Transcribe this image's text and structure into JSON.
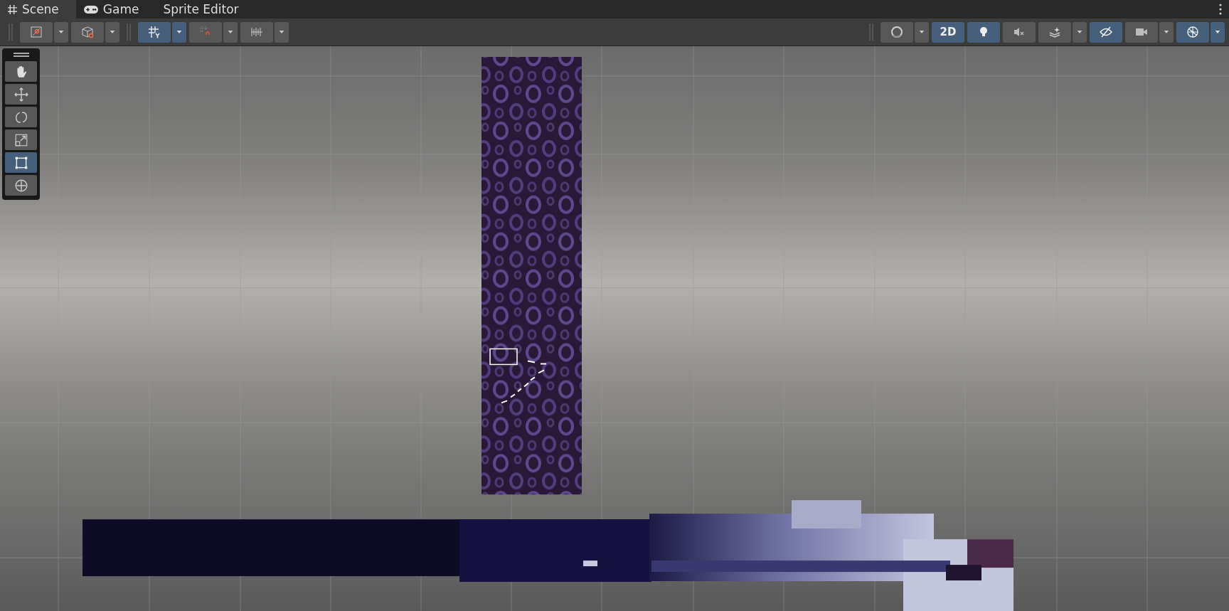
{
  "tabs": [
    {
      "label": "Scene",
      "kind": "scene",
      "selected": true
    },
    {
      "label": "Game",
      "kind": "game",
      "selected": false
    },
    {
      "label": "Sprite Editor",
      "kind": "plain",
      "selected": false
    }
  ],
  "toolbar_left": [
    {
      "kind": "tool-handle",
      "on": false,
      "dropdown": true
    },
    {
      "kind": "orientation",
      "on": false,
      "dropdown": true
    },
    {
      "kind": "grid",
      "on": true,
      "dropdown": true
    },
    {
      "kind": "snap",
      "on": false,
      "dropdown": true
    },
    {
      "kind": "increment",
      "on": false,
      "dropdown": true
    }
  ],
  "toolbar_right": [
    {
      "kind": "shading",
      "on": false,
      "dropdown": true
    },
    {
      "kind": "text",
      "label": "2D",
      "on": true,
      "dropdown": false
    },
    {
      "kind": "lighting",
      "on": true,
      "dropdown": false
    },
    {
      "kind": "audio",
      "on": false,
      "dropdown": false
    },
    {
      "kind": "effects",
      "on": false,
      "dropdown": true
    },
    {
      "kind": "visibility",
      "on": true,
      "dropdown": false
    },
    {
      "kind": "camera",
      "on": false,
      "dropdown": true
    },
    {
      "kind": "gizmos",
      "on": true,
      "dropdown": true
    }
  ],
  "tools": [
    {
      "kind": "hand",
      "selected": false
    },
    {
      "kind": "move",
      "selected": false
    },
    {
      "kind": "rotate",
      "selected": false
    },
    {
      "kind": "scale",
      "selected": false
    },
    {
      "kind": "rect",
      "selected": true
    },
    {
      "kind": "transform",
      "selected": false
    }
  ]
}
